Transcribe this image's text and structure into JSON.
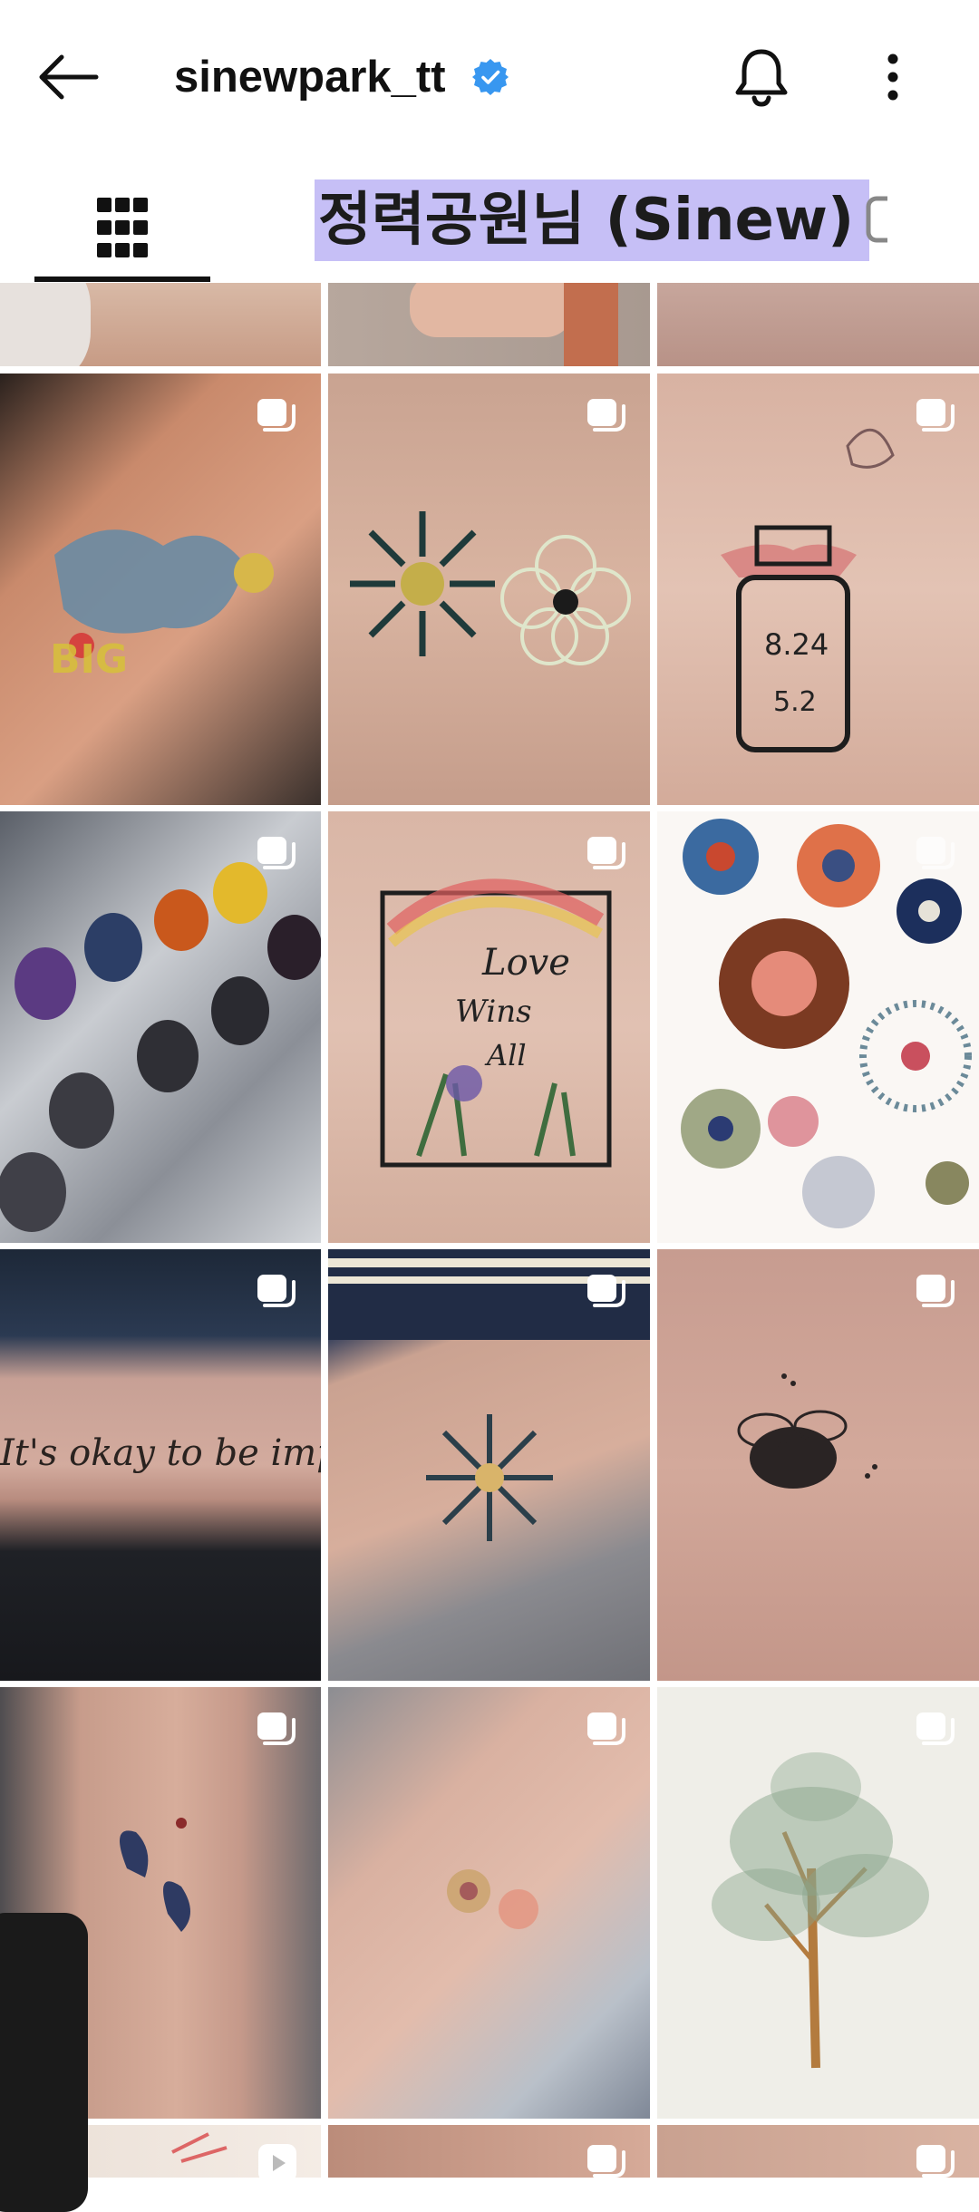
{
  "header": {
    "username": "sinewpark_tt",
    "verified_color": "#3897f0",
    "icons": {
      "back": "back-arrow-icon",
      "verified": "verified-badge-icon",
      "bell": "bell-icon",
      "more": "more-vertical-icon"
    }
  },
  "tabs": {
    "grid_icon": "grid-icon",
    "highlight_label": "정력공원님 (Sinew)",
    "highlight_color": "#c6bff6"
  },
  "grid": {
    "badge_icon": "multiple-posts-icon",
    "reel_icon": "reels-play-icon",
    "posts": [
      {
        "name": "post-arm-partial-1",
        "desc": "partial arm"
      },
      {
        "name": "post-hand-partial"
      },
      {
        "name": "post-skin-partial"
      },
      {
        "name": "post-blue-cat-tattoo"
      },
      {
        "name": "post-sunflower-tattoo"
      },
      {
        "name": "post-perfume-bottle-tattoo"
      },
      {
        "name": "post-ink-caps-photo"
      },
      {
        "name": "post-love-wins-all-tattoo"
      },
      {
        "name": "post-sunflower-sheet"
      },
      {
        "name": "post-imperfect-script-tattoo"
      },
      {
        "name": "post-sun-burst-tattoo"
      },
      {
        "name": "post-bee-tattoo"
      },
      {
        "name": "post-butterfly-tattoo"
      },
      {
        "name": "post-flower-wrist-tattoo"
      },
      {
        "name": "post-tree-sketch"
      },
      {
        "name": "post-bottom-1"
      },
      {
        "name": "post-bottom-2"
      },
      {
        "name": "post-bottom-3"
      }
    ]
  }
}
